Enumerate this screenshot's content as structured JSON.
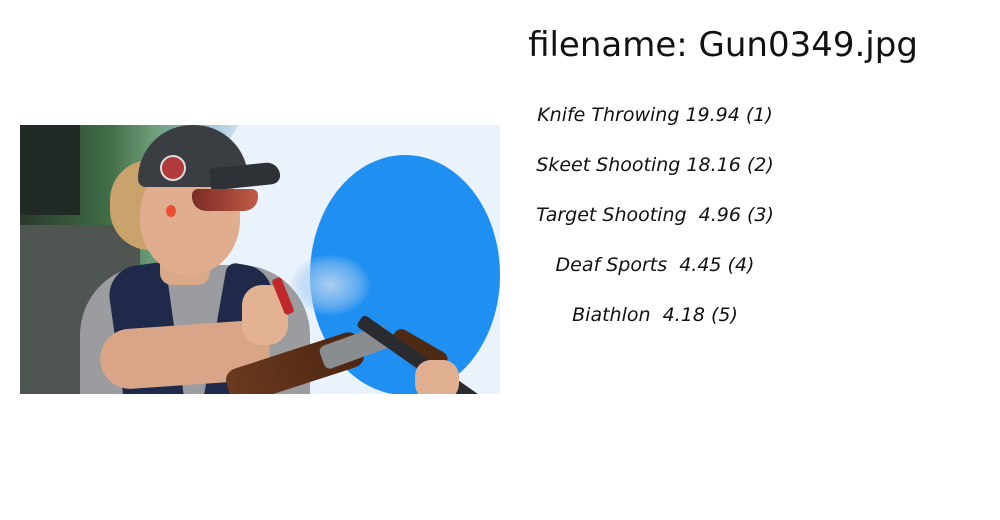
{
  "header": {
    "filename_text": "filename: Gun0349.jpg"
  },
  "image": {
    "subject": "trap-shooting-athlete-photo"
  },
  "predictions": [
    {
      "text": "Knife Throwing 19.94 (1)"
    },
    {
      "text": "Skeet Shooting 18.16 (2)"
    },
    {
      "text": "Target Shooting  4.96 (3)"
    },
    {
      "text": "Deaf Sports  4.45 (4)"
    },
    {
      "text": "Biathlon  4.18 (5)"
    }
  ],
  "colors": {
    "background": "#ffffff",
    "text": "#111111",
    "photo_accent_blue": "#1f8ff1"
  }
}
